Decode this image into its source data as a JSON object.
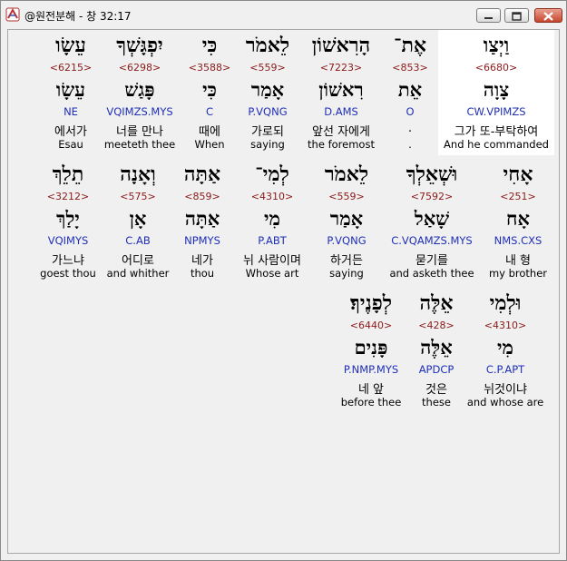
{
  "window": {
    "title": "@원전분해 - 창 32:17"
  },
  "rows": [
    [
      {
        "heb": "עֵשָׂו",
        "strong": "<6215>",
        "lemma": "עֵשָׂו",
        "morph": "NE",
        "kor": "에서가",
        "eng": "Esau"
      },
      {
        "heb": "יִפְגָּשְׁךָ",
        "strong": "<6298>",
        "lemma": "פָּגַשׁ",
        "morph": "VQIMZS.MYS",
        "kor": "너를 만나",
        "eng": "meeteth thee"
      },
      {
        "heb": "כִּי",
        "strong": "<3588>",
        "lemma": "כִּי",
        "morph": "C",
        "kor": "때에",
        "eng": "When"
      },
      {
        "heb": "לֵאמֹר",
        "strong": "<559>",
        "lemma": "אָמַר",
        "morph": "P.VQNG",
        "kor": "가로되",
        "eng": "saying"
      },
      {
        "heb": "הָרִאשׁוֹן",
        "strong": "<7223>",
        "lemma": "רִאשׁוֹן",
        "morph": "D.AMS",
        "kor": "앞선 자에게",
        "eng": "the foremost"
      },
      {
        "heb": "אֶת־",
        "strong": "<853>",
        "lemma": "אֵת",
        "morph": "O",
        "kor": ".",
        "eng": "."
      },
      {
        "heb": "וַיְצַו",
        "strong": "<6680>",
        "lemma": "צָוָה",
        "morph": "CW.VPIMZS",
        "kor": "그가 또-부탁하여",
        "eng": "And he commanded",
        "highlight": true
      }
    ],
    [
      {
        "heb": "תֵלֵךְ",
        "strong": "<3212>",
        "lemma": "יָלַךְ",
        "morph": "VQIMYS",
        "kor": "가느냐",
        "eng": "goest thou"
      },
      {
        "heb": "וְאָנָה",
        "strong": "<575>",
        "lemma": "אָן",
        "morph": "C.AB",
        "kor": "어디로",
        "eng": "and whither"
      },
      {
        "heb": "אַתָּה",
        "strong": "<859>",
        "lemma": "אַתָּה",
        "morph": "NPMYS",
        "kor": "네가",
        "eng": "thou"
      },
      {
        "heb": "לְמִי־",
        "strong": "<4310>",
        "lemma": "מִי",
        "morph": "P.ABT",
        "kor": "뉘 사람이며",
        "eng": "Whose art"
      },
      {
        "heb": "לֵאמֹר",
        "strong": "<559>",
        "lemma": "אָמַר",
        "morph": "P.VQNG",
        "kor": "하거든",
        "eng": "saying"
      },
      {
        "heb": "וּשְׁאֵלְךָ",
        "strong": "<7592>",
        "lemma": "שָׁאַל",
        "morph": "C.VQAMZS.MYS",
        "kor": "묻기를",
        "eng": "and asketh thee"
      },
      {
        "heb": "אָחִי",
        "strong": "<251>",
        "lemma": "אָח",
        "morph": "NMS.CXS",
        "kor": "내 형",
        "eng": "my brother"
      }
    ],
    [
      {
        "heb": "לְפָנֶיךָ׃",
        "strong": "<6440>",
        "lemma": "פָּנִים",
        "morph": "P.NMP.MYS",
        "kor": "네 앞",
        "eng": "before thee"
      },
      {
        "heb": "אֵלֶּה",
        "strong": "<428>",
        "lemma": "אֵלֶּה",
        "morph": "APDCP",
        "kor": "것은",
        "eng": "these"
      },
      {
        "heb": "וּלְמִי",
        "strong": "<4310>",
        "lemma": "מִי",
        "morph": "C.P.APT",
        "kor": "뉘것이냐",
        "eng": "and whose are"
      }
    ]
  ]
}
